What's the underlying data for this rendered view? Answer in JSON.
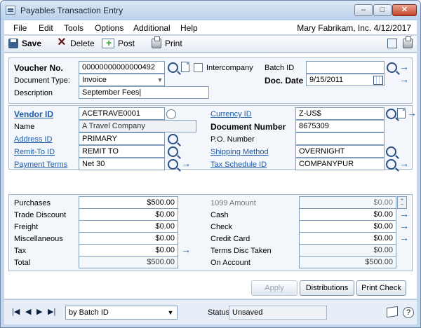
{
  "window": {
    "title": "Payables Transaction Entry",
    "minimize": "–",
    "maximize": "□",
    "close": "✕"
  },
  "menu": {
    "items": [
      "File",
      "Edit",
      "Tools",
      "Options",
      "Additional",
      "Help"
    ],
    "company": "Mary  Fabrikam, Inc.  4/12/2017"
  },
  "toolbar": {
    "save": "Save",
    "delete": "Delete",
    "post": "Post",
    "print": "Print"
  },
  "header": {
    "voucher_label": "Voucher No.",
    "voucher_value": "00000000000000492",
    "intercompany_label": "Intercompany",
    "intercompany_checked": false,
    "batch_label": "Batch ID",
    "batch_value": "",
    "doc_type_label": "Document Type:",
    "doc_type_value": "Invoice",
    "doc_date_label": "Doc. Date",
    "doc_date_value": "9/15/2011",
    "description_label": "Description",
    "description_value": "September Fees|"
  },
  "vendor": {
    "vendor_label": "Vendor ID",
    "vendor_value": "ACETRAVE0001",
    "name_label": "Name",
    "name_value": "A Travel Company",
    "address_label": "Address ID",
    "address_value": "PRIMARY",
    "remit_label": "Remit-To ID",
    "remit_value": "REMIT TO",
    "terms_label": "Payment Terms",
    "terms_value": "Net 30",
    "currency_label": "Currency ID",
    "currency_value": "Z-US$",
    "doc_number_label": "Document Number",
    "doc_number_value": "8675309",
    "po_label": "P.O. Number",
    "po_value": "",
    "shipping_label": "Shipping Method",
    "shipping_value": "OVERNIGHT",
    "tax_schedule_label": "Tax Schedule ID",
    "tax_schedule_value": "COMPANYPUR"
  },
  "amounts_left": [
    {
      "label": "Purchases",
      "value": "$500.00"
    },
    {
      "label": "Trade Discount",
      "value": "$0.00"
    },
    {
      "label": "Freight",
      "value": "$0.00"
    },
    {
      "label": "Miscellaneous",
      "value": "$0.00"
    },
    {
      "label": "Tax",
      "value": "$0.00"
    },
    {
      "label": "Total",
      "value": "$500.00"
    }
  ],
  "amounts_right": [
    {
      "label": "1099 Amount",
      "value": "$0.00"
    },
    {
      "label": "Cash",
      "value": "$0.00"
    },
    {
      "label": "Check",
      "value": "$0.00"
    },
    {
      "label": "Credit Card",
      "value": "$0.00"
    },
    {
      "label": "Terms Disc Taken",
      "value": "$0.00"
    },
    {
      "label": "On Account",
      "value": "$500.00"
    }
  ],
  "buttons": {
    "apply": "Apply",
    "distributions": "Distributions",
    "print_check": "Print Check"
  },
  "footer": {
    "sort_value": "by Batch ID",
    "status_label": "Status",
    "status_value": "Unsaved"
  }
}
